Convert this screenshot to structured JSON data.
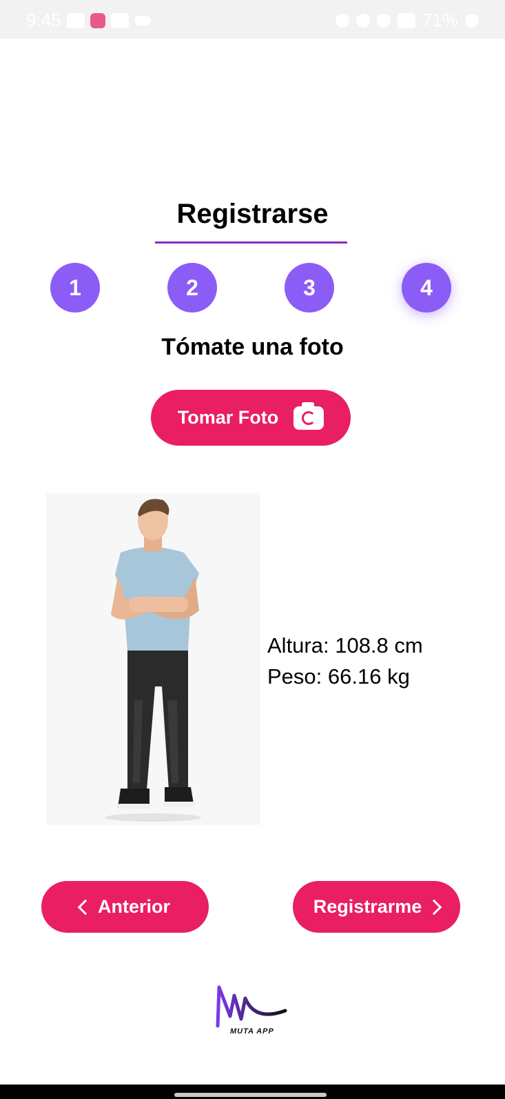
{
  "status_bar": {
    "time": "9:45",
    "battery": "71%",
    "icons_left": [
      "youtube-icon",
      "hearts-icon",
      "gallery-icon",
      "cloud-icon"
    ],
    "icons_right": [
      "alarm-icon",
      "mute-icon",
      "wifi-icon",
      "signal-icon",
      "battery-icon"
    ]
  },
  "header": {
    "title": "Registrarse"
  },
  "steps": [
    {
      "label": "1"
    },
    {
      "label": "2"
    },
    {
      "label": "3"
    },
    {
      "label": "4",
      "active": true
    }
  ],
  "content": {
    "subtitle": "Tómate una foto",
    "take_photo_label": "Tomar Foto",
    "measurements": {
      "height": "Altura: 108.8 cm",
      "weight": "Peso: 66.16 kg"
    }
  },
  "navigation": {
    "prev_label": "Anterior",
    "next_label": "Registrarme"
  },
  "logo": {
    "text": "MUTA APP"
  },
  "colors": {
    "accent": "#e91e63",
    "step": "#8b5cf6",
    "underline": "#8a2bbf"
  }
}
